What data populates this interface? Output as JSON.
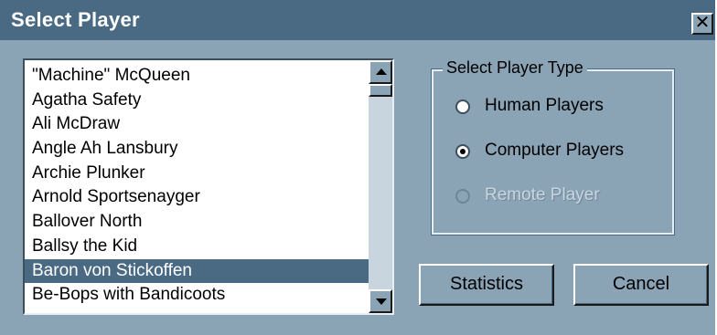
{
  "window": {
    "title": "Select Player",
    "close_glyph": "✕"
  },
  "players": [
    {
      "name": "\"Machine\" McQueen",
      "selected": false
    },
    {
      "name": "Agatha Safety",
      "selected": false
    },
    {
      "name": "Ali McDraw",
      "selected": false
    },
    {
      "name": "Angle Ah Lansbury",
      "selected": false
    },
    {
      "name": "Archie Plunker",
      "selected": false
    },
    {
      "name": "Arnold Sportsenayger",
      "selected": false
    },
    {
      "name": "Ballover North",
      "selected": false
    },
    {
      "name": "Ballsy the Kid",
      "selected": false
    },
    {
      "name": "Baron von Stickoffen",
      "selected": true
    },
    {
      "name": "Be-Bops with Bandicoots",
      "selected": false
    }
  ],
  "player_type": {
    "legend": "Select Player Type",
    "options": [
      {
        "label": "Human Players",
        "checked": false,
        "enabled": true
      },
      {
        "label": "Computer Players",
        "checked": true,
        "enabled": true
      },
      {
        "label": "Remote Player",
        "checked": false,
        "enabled": false
      }
    ]
  },
  "buttons": {
    "statistics": "Statistics",
    "cancel": "Cancel"
  },
  "icons": {
    "scroll_up": "scroll-up-arrow-icon",
    "scroll_down": "scroll-down-arrow-icon"
  },
  "colors": {
    "dialog_bg": "#8aa3b5",
    "titlebar_bg": "#4a6a84",
    "selection_bg": "#4a6a84"
  }
}
